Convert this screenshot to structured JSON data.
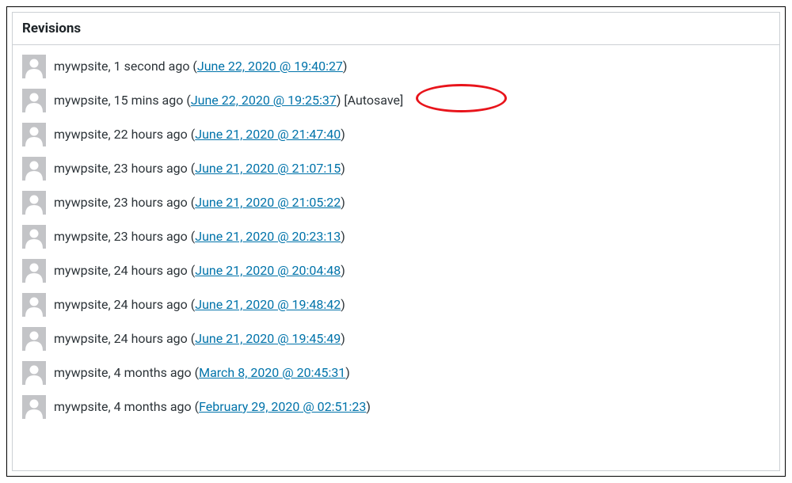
{
  "panel": {
    "title": "Revisions"
  },
  "revisions": [
    {
      "author": "mywpsite",
      "ago": "1 second ago",
      "datetime": "June 22, 2020 @ 19:40:27",
      "suffix": "",
      "highlight": false
    },
    {
      "author": "mywpsite",
      "ago": "15 mins ago",
      "datetime": "June 22, 2020 @ 19:25:37",
      "suffix": " [Autosave]",
      "highlight": true
    },
    {
      "author": "mywpsite",
      "ago": "22 hours ago",
      "datetime": "June 21, 2020 @ 21:47:40",
      "suffix": "",
      "highlight": false
    },
    {
      "author": "mywpsite",
      "ago": "23 hours ago",
      "datetime": "June 21, 2020 @ 21:07:15",
      "suffix": "",
      "highlight": false
    },
    {
      "author": "mywpsite",
      "ago": "23 hours ago",
      "datetime": "June 21, 2020 @ 21:05:22",
      "suffix": "",
      "highlight": false
    },
    {
      "author": "mywpsite",
      "ago": "23 hours ago",
      "datetime": "June 21, 2020 @ 20:23:13",
      "suffix": "",
      "highlight": false
    },
    {
      "author": "mywpsite",
      "ago": "24 hours ago",
      "datetime": "June 21, 2020 @ 20:04:48",
      "suffix": "",
      "highlight": false
    },
    {
      "author": "mywpsite",
      "ago": "24 hours ago",
      "datetime": "June 21, 2020 @ 19:48:42",
      "suffix": "",
      "highlight": false
    },
    {
      "author": "mywpsite",
      "ago": "24 hours ago",
      "datetime": "June 21, 2020 @ 19:45:49",
      "suffix": "",
      "highlight": false
    },
    {
      "author": "mywpsite",
      "ago": "4 months ago",
      "datetime": "March 8, 2020 @ 20:45:31",
      "suffix": "",
      "highlight": false
    },
    {
      "author": "mywpsite",
      "ago": "4 months ago",
      "datetime": "February 29, 2020 @ 02:51:23",
      "suffix": "",
      "highlight": false
    }
  ]
}
